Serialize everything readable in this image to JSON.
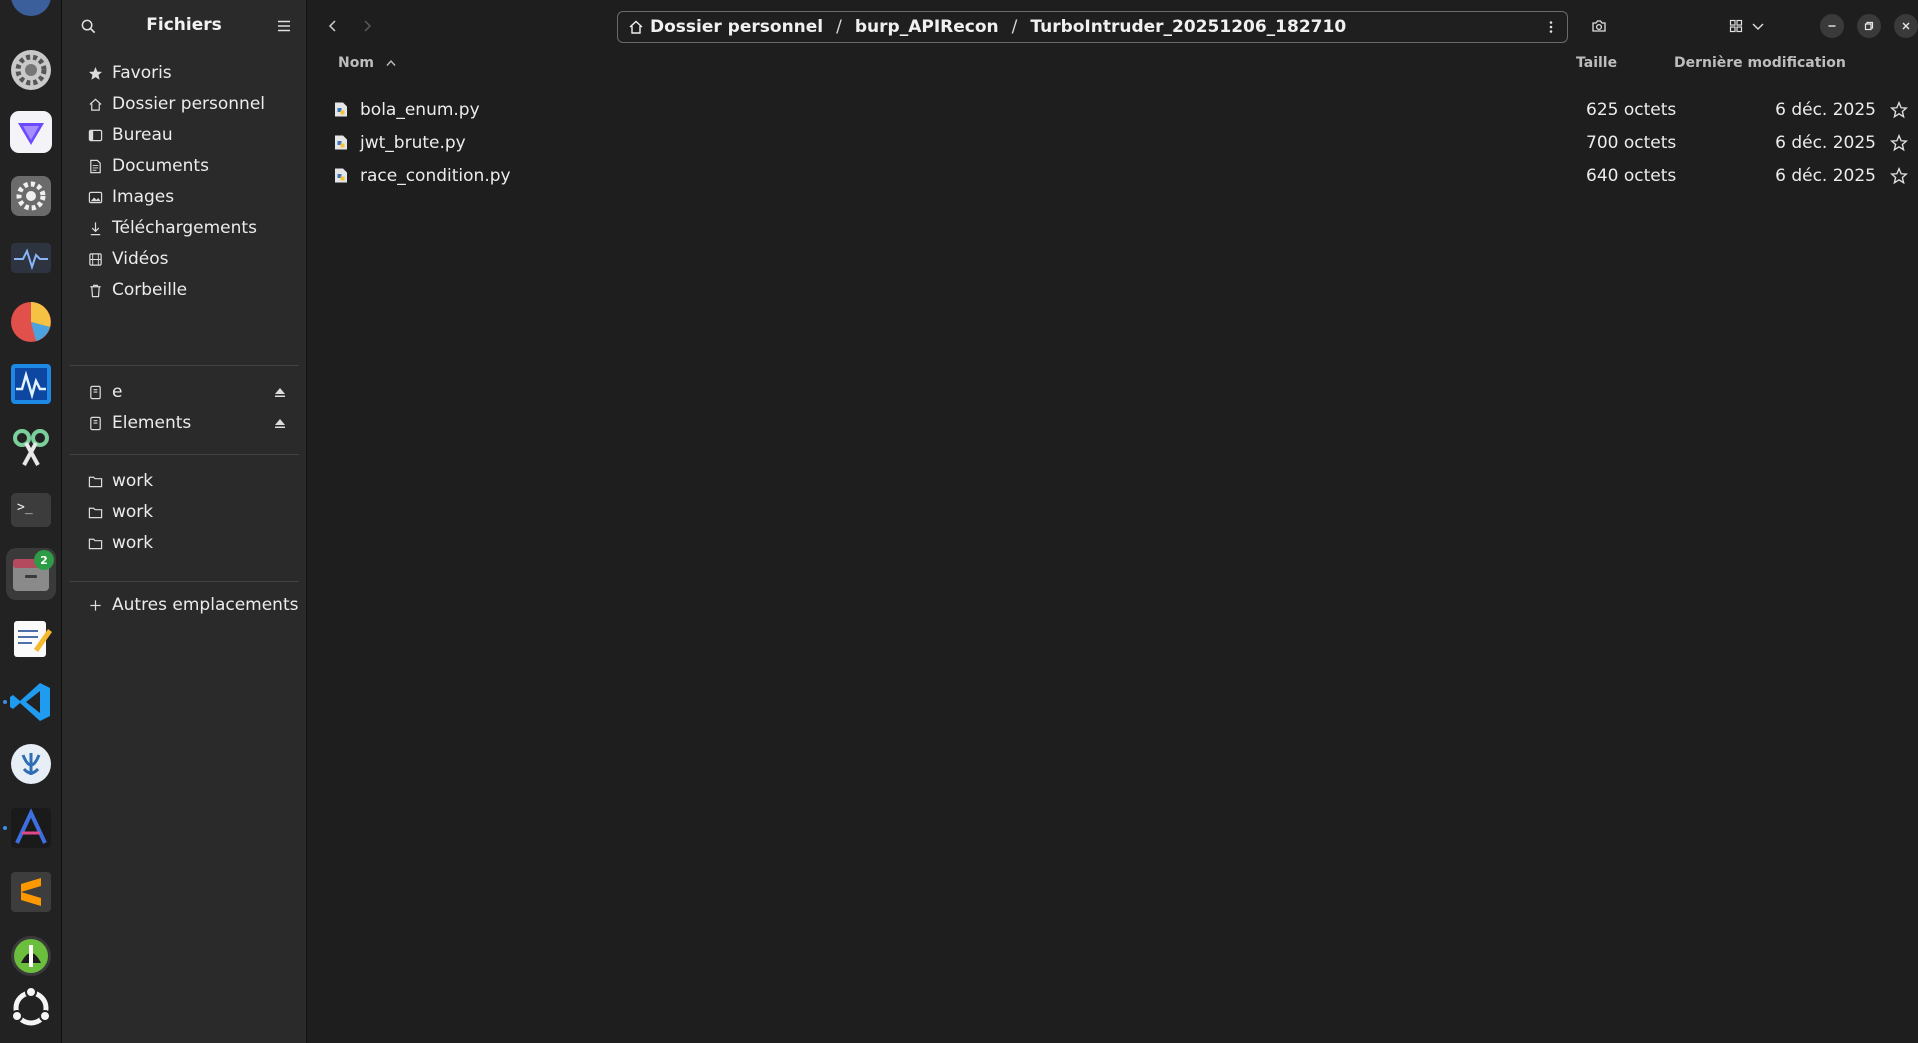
{
  "sidebar": {
    "title": "Fichiers",
    "places": [
      {
        "label": "Favoris",
        "icon": "star-icon"
      },
      {
        "label": "Dossier personnel",
        "icon": "home-icon"
      },
      {
        "label": "Bureau",
        "icon": "desktop-icon"
      },
      {
        "label": "Documents",
        "icon": "document-icon"
      },
      {
        "label": "Images",
        "icon": "image-icon"
      },
      {
        "label": "Téléchargements",
        "icon": "download-icon"
      },
      {
        "label": "Vidéos",
        "icon": "video-icon"
      },
      {
        "label": "Corbeille",
        "icon": "trash-icon"
      }
    ],
    "devices": [
      {
        "label": "e",
        "icon": "drive-icon"
      },
      {
        "label": "Elements",
        "icon": "drive-icon"
      }
    ],
    "bookmarks": [
      {
        "label": "work",
        "icon": "folder-icon"
      },
      {
        "label": "work",
        "icon": "folder-icon"
      },
      {
        "label": "work",
        "icon": "folder-icon"
      }
    ],
    "other": {
      "label": "Autres emplacements",
      "icon": "plus-icon"
    }
  },
  "path": {
    "segments": [
      "Dossier personnel",
      "burp_APIRecon",
      "TurboIntruder_20251206_182710"
    ]
  },
  "columns": {
    "name": "Nom",
    "size": "Taille",
    "modified": "Dernière modification"
  },
  "files": [
    {
      "name": "bola_enum.py",
      "size": "625 octets",
      "modified": "6 déc. 2025"
    },
    {
      "name": "jwt_brute.py",
      "size": "700 octets",
      "modified": "6 déc. 2025"
    },
    {
      "name": "race_condition.py",
      "size": "640 octets",
      "modified": "6 déc. 2025"
    }
  ],
  "dock": {
    "files_badge": "2"
  },
  "colors": {
    "sidebar_bg": "#2a2a2a",
    "main_bg": "#1e1e1e",
    "dock_bg": "#222222",
    "text": "#ececec"
  }
}
